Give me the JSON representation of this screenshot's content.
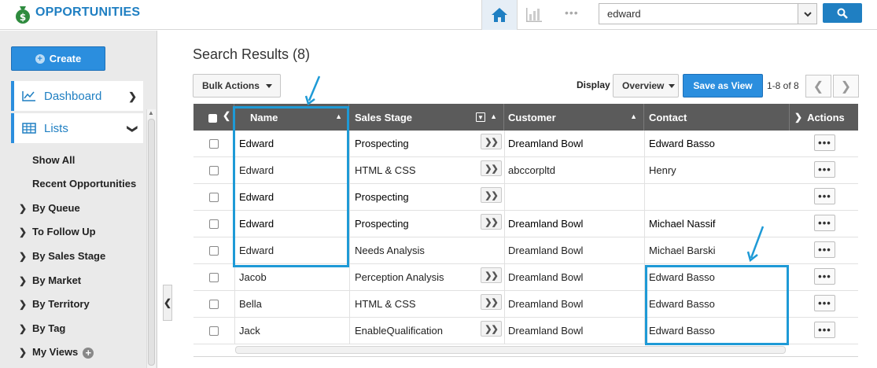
{
  "header": {
    "app_title": "OPPORTUNITIES",
    "logo_icon": "money-bag-icon",
    "nav_icons": [
      "home-icon",
      "bar-chart-icon",
      "more-dots-icon"
    ],
    "search": {
      "value": "edward",
      "dots": "•••"
    },
    "colors": {
      "brand": "#1f7fc2",
      "accent": "#2b8ede"
    }
  },
  "sidebar": {
    "create_label": "Create",
    "cards": [
      {
        "label": "Dashboard",
        "icon": "line-chart-icon"
      },
      {
        "label": "Lists",
        "icon": "table-icon"
      }
    ],
    "sub_items": [
      "Show All",
      "Recent Opportunities"
    ],
    "groups": [
      "By Queue",
      "To Follow Up",
      "By Sales Stage",
      "By Market",
      "By Territory",
      "By Tag",
      "My Views"
    ]
  },
  "main": {
    "title": "Search Results (8)",
    "bulk_actions_label": "Bulk Actions",
    "display_label": "Display",
    "view_select": "Overview",
    "save_view_label": "Save as View",
    "pager_text": "1-8 of 8",
    "table": {
      "columns": [
        "Name",
        "Sales Stage",
        "Customer",
        "Contact",
        "Actions"
      ],
      "rows": [
        {
          "name": "Edward",
          "stage": "Prospecting",
          "customer": "Dreamland Bowl",
          "contact": "Edward Basso",
          "bold": true,
          "stage_btn": true
        },
        {
          "name": "Edward",
          "stage": "HTML & CSS",
          "customer": "abccorpltd",
          "contact": "Henry",
          "bold": false,
          "stage_btn": true
        },
        {
          "name": "Edward",
          "stage": "Prospecting",
          "customer": "",
          "contact": "",
          "bold": true,
          "stage_btn": true
        },
        {
          "name": "Edward",
          "stage": "Prospecting",
          "customer": "Dreamland Bowl",
          "contact": "Michael Nassif",
          "bold": true,
          "stage_btn": true
        },
        {
          "name": "Edward",
          "stage": "Needs Analysis",
          "customer": "Dreamland Bowl",
          "contact": "Michael Barski",
          "bold": false,
          "stage_btn": false
        },
        {
          "name": "Jacob",
          "stage": "Perception Analysis",
          "customer": "Dreamland Bowl",
          "contact": "Edward Basso",
          "bold": false,
          "stage_btn": true
        },
        {
          "name": "Bella",
          "stage": "HTML & CSS",
          "customer": "Dreamland Bowl",
          "contact": "Edward Basso",
          "bold": false,
          "stage_btn": true
        },
        {
          "name": "Jack",
          "stage": "EnableQualification",
          "customer": "Dreamland Bowl",
          "contact": "Edward Basso",
          "bold": false,
          "stage_btn": true
        }
      ]
    }
  }
}
